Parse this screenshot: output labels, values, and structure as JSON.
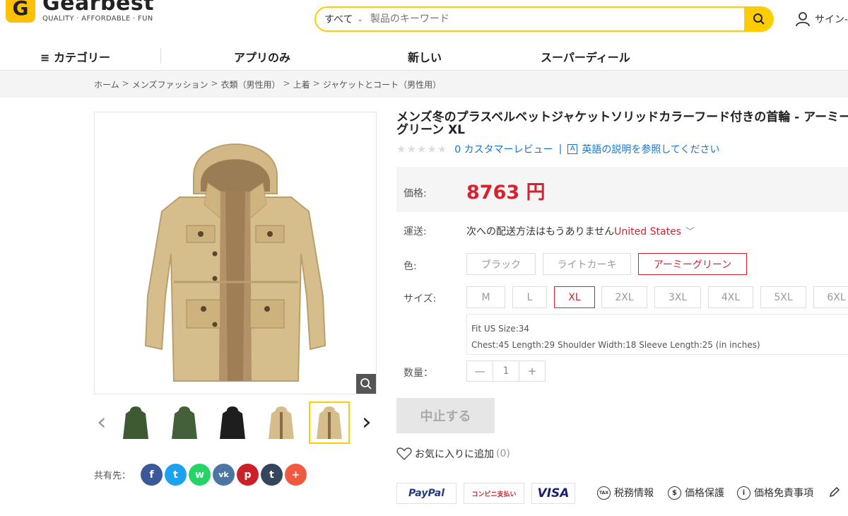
{
  "header": {
    "logo_letter": "G",
    "logo_name": "Gearbest",
    "logo_tagline": "QUALITY · AFFORDABLE · FUN",
    "search_category": "すべて",
    "search_placeholder": "製品のキーワード",
    "signin": "サイン-"
  },
  "nav": {
    "categories": "≡ カテゴリー",
    "app_only": "アプリのみ",
    "new": "新しい",
    "super_deals": "スーパーディール"
  },
  "breadcrumb": [
    "ホーム",
    "メンズファッション",
    "衣類（男性用）",
    "上着",
    "ジャケットとコート（男性用）"
  ],
  "product": {
    "title": "メンズ冬のプラスベルベットジャケットソリッドカラーフード付きの首輪 - アーミーグリーン XL",
    "reviews": "0 カスタマーレビュー",
    "english_desc": "英語の説明を参照してください",
    "price_label": "価格:",
    "price": "8763 円",
    "shipping_label": "運送:",
    "shipping_text": "次への配送方法はもうありません",
    "shipping_country": "United States",
    "color_label": "色:",
    "colors": [
      "ブラック",
      "ライトカーキ",
      "アーミーグリーン"
    ],
    "selected_color": "アーミーグリーン",
    "size_label": "サイズ:",
    "sizes": [
      "M",
      "L",
      "XL",
      "2XL",
      "3XL",
      "4XL",
      "5XL",
      "6XL"
    ],
    "selected_size": "XL",
    "fit_line": "Fit US Size:34",
    "measure_line": "Chest:45  Length:29  Shoulder Width:18  Sleeve Length:25  (in inches)",
    "qty_label": "数量：",
    "qty_minus": "—",
    "qty_value": "1",
    "qty_plus": "+",
    "stop_button": "中止する",
    "wishlist": "お気に入りに追加",
    "wishlist_count": "(0)"
  },
  "share": {
    "label": "共有先：",
    "icons": [
      "f",
      "t",
      "w",
      "vk",
      "p",
      "t",
      "+"
    ]
  },
  "payments": {
    "paypal": "PayPal",
    "konbini": "コンビニ支払い",
    "visa": "VISA"
  },
  "trust": {
    "tax": "税務情報",
    "price_protect": "価格保護",
    "disclaimer": "価格免責事項",
    "tax_icon_text": "TAX"
  },
  "colors": {
    "accent_yellow": "#ffcc00",
    "price_red": "#d8202f",
    "link_blue": "#1a73c7"
  }
}
